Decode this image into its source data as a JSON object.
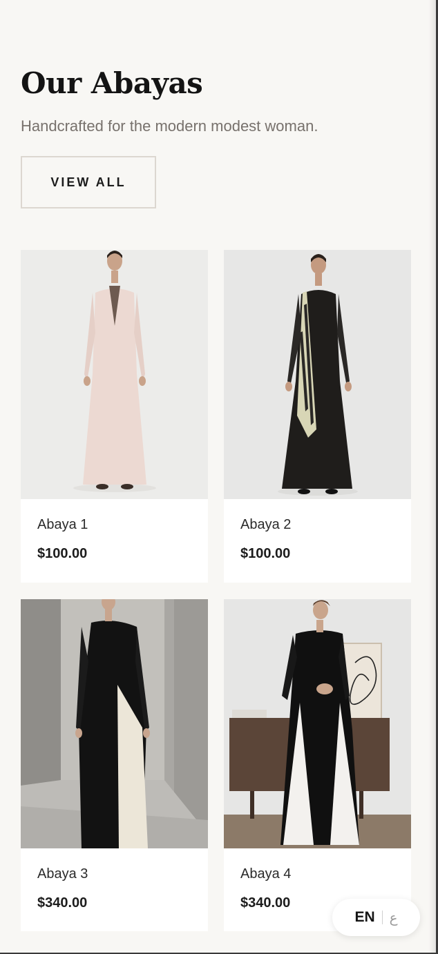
{
  "section": {
    "title": "Our Abayas",
    "subtitle": "Handcrafted for the modern modest woman.",
    "view_all_label": "VIEW ALL"
  },
  "products": [
    {
      "name": "Abaya 1",
      "price": "$100.00"
    },
    {
      "name": "Abaya 2",
      "price": "$100.00"
    },
    {
      "name": "Abaya 3",
      "price": "$340.00"
    },
    {
      "name": "Abaya 4",
      "price": "$340.00"
    }
  ],
  "language_toggle": {
    "active": "EN",
    "alternate": "ع"
  },
  "colors": {
    "page_background": "#f8f7f4",
    "card_background": "#ffffff",
    "subtitle_text": "#77716c",
    "button_border": "#dcd7d0"
  }
}
